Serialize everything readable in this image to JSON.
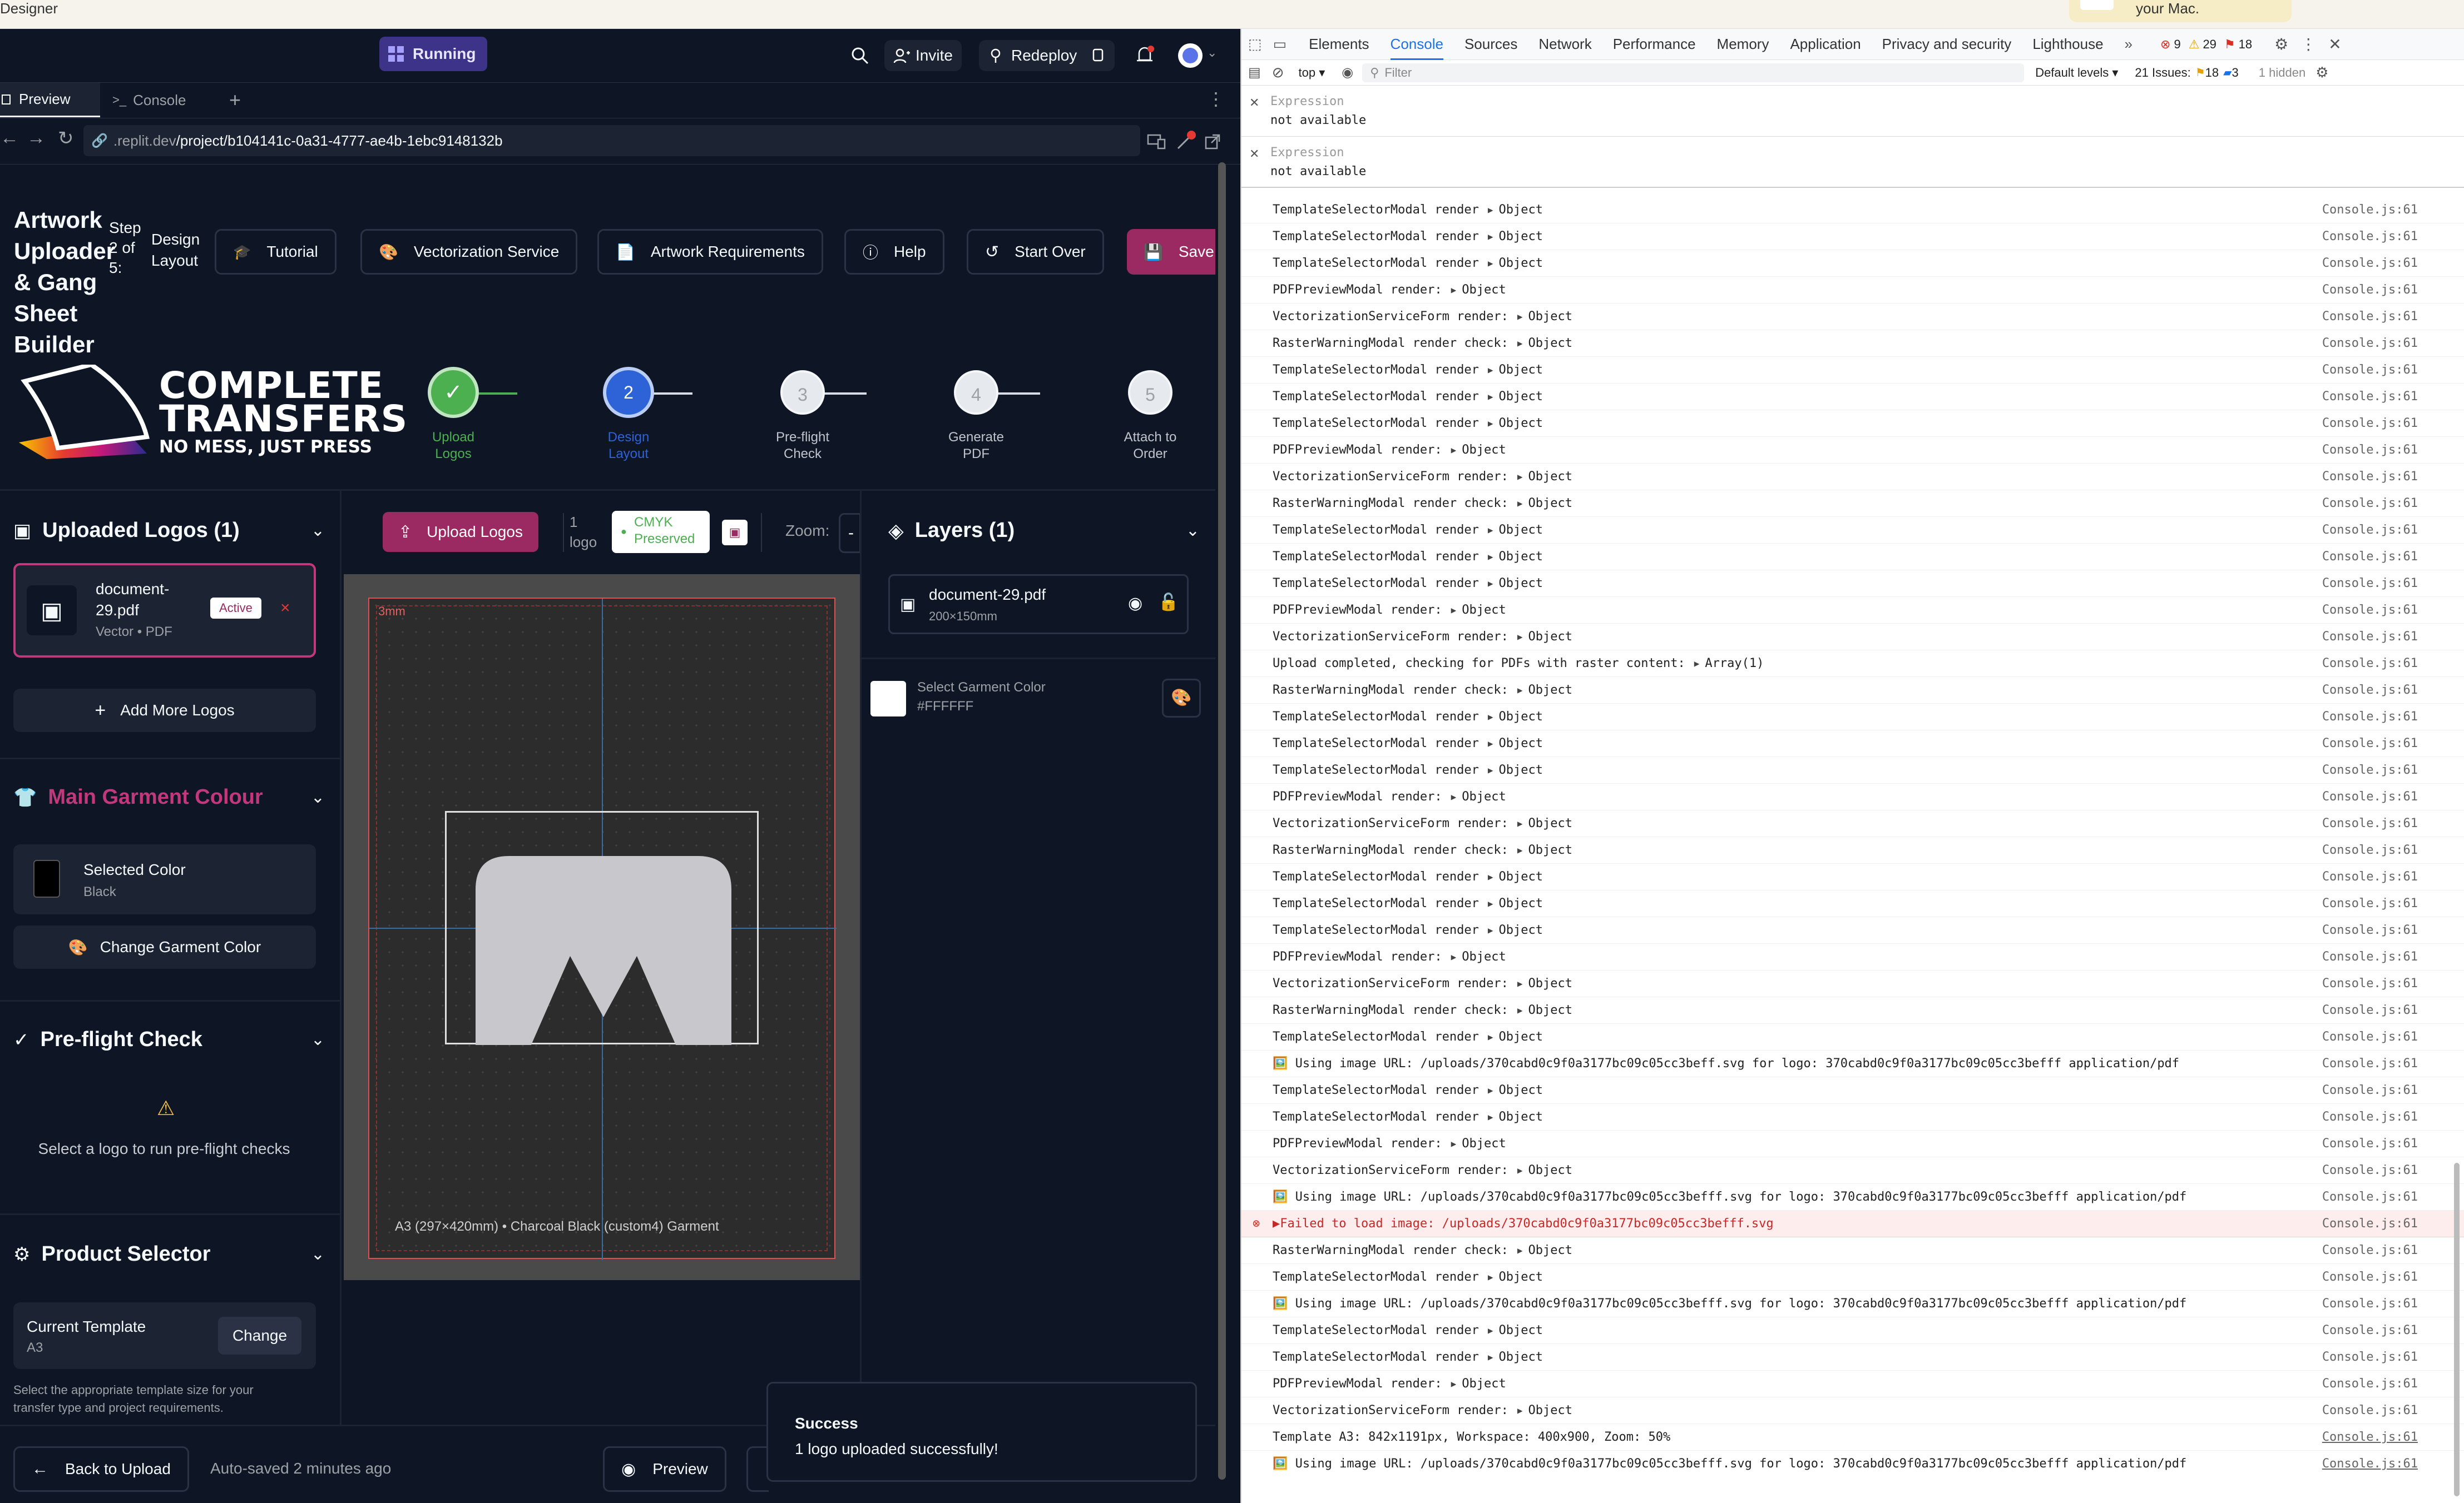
{
  "mac": {
    "app_name": "Designer",
    "notification": "your Mac."
  },
  "replit": {
    "running": "Running",
    "invite": "Invite",
    "redeploy": "Redeploy",
    "tabs": [
      {
        "label": "Preview"
      },
      {
        "label": "Console"
      }
    ],
    "url_dim": ".replit.dev",
    "url_path": "/project/b104141c-0a31-4777-ae4b-1ebc9148132b",
    "title": [
      "Artwork",
      "Uploader",
      "& Gang",
      "Sheet",
      "Builder"
    ],
    "step": [
      "Step",
      "2 of",
      "5:"
    ],
    "step_name": [
      "Design",
      "Layout"
    ],
    "toolbar": {
      "tutorial": "Tutorial",
      "vectorization": "Vectorization Service",
      "requirements": "Artwork Requirements",
      "help": "Help",
      "start_over": "Start Over",
      "save": "Save"
    },
    "logo": {
      "line1": "COMPLETE",
      "line2": "TRANSFERS",
      "tagline": "NO MESS, JUST PRESS"
    },
    "steps": [
      {
        "num": "✓",
        "l1": "Upload",
        "l2": "Logos"
      },
      {
        "num": "2",
        "l1": "Design",
        "l2": "Layout"
      },
      {
        "num": "3",
        "l1": "Pre-flight",
        "l2": "Check"
      },
      {
        "num": "4",
        "l1": "Generate",
        "l2": "PDF"
      },
      {
        "num": "5",
        "l1": "Attach to",
        "l2": "Order"
      }
    ],
    "left": {
      "uploaded_title": "Uploaded Logos (1)",
      "file_name_1": "document-",
      "file_name_2": "29.pdf",
      "file_meta": "Vector • PDF",
      "active": "Active",
      "add_more": "Add More Logos",
      "garment_title": "Main Garment Colour",
      "selected_color_label": "Selected Color",
      "selected_color_value": "Black",
      "change_color": "Change Garment Color",
      "preflight_title": "Pre-flight Check",
      "preflight_msg": "Select a logo to run pre-flight checks",
      "product_title": "Product Selector",
      "current_template_label": "Current Template",
      "current_template_value": "A3",
      "change": "Change",
      "product_desc_1": "Select the appropriate template size for your",
      "product_desc_2": "transfer type and project requirements."
    },
    "canvas": {
      "upload": "Upload Logos",
      "count_1": "1",
      "count_2": "logo",
      "cmyk_1": "CMYK",
      "cmyk_2": "Preserved",
      "zoom": "Zoom:",
      "bleed": "3mm",
      "footer": "A3 (297×420mm) • Charcoal Black (custom4) Garment"
    },
    "layers": {
      "title": "Layers (1)",
      "file": "document-29.pdf",
      "size": "200×150mm",
      "garment_label": "Select Garment Color",
      "garment_hex": "#FFFFFF"
    },
    "bottom": {
      "back": "Back to Upload",
      "autosave": "Auto-saved 2 minutes ago",
      "preview": "Preview"
    },
    "toast": {
      "title": "Success",
      "msg": "1 logo uploaded successfully!"
    },
    "colors": {
      "accent": "#9b2a62",
      "garment_title": "#c2387c",
      "success": "#4caf50",
      "step_active": "#2d63d6",
      "bg": "#0e1525"
    }
  },
  "devtools": {
    "tabs": [
      "Elements",
      "Console",
      "Sources",
      "Network",
      "Performance",
      "Memory",
      "Application",
      "Privacy and security",
      "Lighthouse"
    ],
    "badges": {
      "errors": "9",
      "warnings": "29",
      "issues": "18"
    },
    "context": "top",
    "filter": "Filter",
    "levels": "Default levels",
    "issues_label": "21 Issues:",
    "issues_warn": "18",
    "issues_info": "3",
    "hidden": "1 hidden",
    "expressions": [
      {
        "label": "Expression",
        "value": "not available"
      },
      {
        "label": "Expression",
        "value": "not available"
      }
    ],
    "logs": [
      {
        "text": "TemplateSelectorModal render",
        "obj": "Object"
      },
      {
        "text": "TemplateSelectorModal render",
        "obj": "Object"
      },
      {
        "text": "TemplateSelectorModal render",
        "obj": "Object"
      },
      {
        "text": "PDFPreviewModal render:",
        "obj": "Object"
      },
      {
        "text": "VectorizationServiceForm render:",
        "obj": "Object"
      },
      {
        "text": "RasterWarningModal render check:",
        "obj": "Object"
      },
      {
        "text": "TemplateSelectorModal render",
        "obj": "Object"
      },
      {
        "text": "TemplateSelectorModal render",
        "obj": "Object"
      },
      {
        "text": "TemplateSelectorModal render",
        "obj": "Object"
      },
      {
        "text": "PDFPreviewModal render:",
        "obj": "Object"
      },
      {
        "text": "VectorizationServiceForm render:",
        "obj": "Object"
      },
      {
        "text": "RasterWarningModal render check:",
        "obj": "Object"
      },
      {
        "text": "TemplateSelectorModal render",
        "obj": "Object"
      },
      {
        "text": "TemplateSelectorModal render",
        "obj": "Object"
      },
      {
        "text": "TemplateSelectorModal render",
        "obj": "Object"
      },
      {
        "text": "PDFPreviewModal render:",
        "obj": "Object"
      },
      {
        "text": "VectorizationServiceForm render:",
        "obj": "Object"
      },
      {
        "text": "Upload completed, checking for PDFs with raster content:",
        "obj": "Array(1)"
      },
      {
        "text": "RasterWarningModal render check:",
        "obj": "Object"
      },
      {
        "text": "TemplateSelectorModal render",
        "obj": "Object"
      },
      {
        "text": "TemplateSelectorModal render",
        "obj": "Object"
      },
      {
        "text": "TemplateSelectorModal render",
        "obj": "Object"
      },
      {
        "text": "PDFPreviewModal render:",
        "obj": "Object"
      },
      {
        "text": "VectorizationServiceForm render:",
        "obj": "Object"
      },
      {
        "text": "RasterWarningModal render check:",
        "obj": "Object"
      },
      {
        "text": "TemplateSelectorModal render",
        "obj": "Object"
      },
      {
        "text": "TemplateSelectorModal render",
        "obj": "Object"
      },
      {
        "text": "TemplateSelectorModal render",
        "obj": "Object"
      },
      {
        "text": "PDFPreviewModal render:",
        "obj": "Object"
      },
      {
        "text": "VectorizationServiceForm render:",
        "obj": "Object"
      },
      {
        "text": "RasterWarningModal render check:",
        "obj": "Object"
      },
      {
        "text": "TemplateSelectorModal render",
        "obj": "Object"
      },
      {
        "text": "🖼️ Using image URL: /uploads/370cabd0c9f0a3177bc09c05cc3beff.svg for logo: 370cabd0c9f0a3177bc09c05cc3befff application/pdf",
        "obj": ""
      },
      {
        "text": "TemplateSelectorModal render",
        "obj": "Object"
      },
      {
        "text": "TemplateSelectorModal render",
        "obj": "Object"
      },
      {
        "text": "PDFPreviewModal render:",
        "obj": "Object"
      },
      {
        "text": "VectorizationServiceForm render:",
        "obj": "Object"
      },
      {
        "text": "🖼️ Using image URL: /uploads/370cabd0c9f0a3177bc09c05cc3befff.svg for logo: 370cabd0c9f0a3177bc09c05cc3befff application/pdf",
        "obj": ""
      },
      {
        "text": "▶Failed to load image: /uploads/370cabd0c9f0a3177bc09c05cc3befff.svg",
        "obj": "",
        "err": true
      },
      {
        "text": "RasterWarningModal render check:",
        "obj": "Object"
      },
      {
        "text": "TemplateSelectorModal render",
        "obj": "Object"
      },
      {
        "text": "🖼️ Using image URL: /uploads/370cabd0c9f0a3177bc09c05cc3befff.svg for logo: 370cabd0c9f0a3177bc09c05cc3befff application/pdf",
        "obj": ""
      },
      {
        "text": "TemplateSelectorModal render",
        "obj": "Object"
      },
      {
        "text": "TemplateSelectorModal render",
        "obj": "Object"
      },
      {
        "text": "PDFPreviewModal render:",
        "obj": "Object"
      },
      {
        "text": "VectorizationServiceForm render:",
        "obj": "Object"
      },
      {
        "text": "Template A3: 842x1191px, Workspace: 400x900, Zoom: 50%",
        "obj": ""
      },
      {
        "text": "🖼️ Using image URL: /uploads/370cabd0c9f0a3177bc09c05cc3befff.svg for logo: 370cabd0c9f0a3177bc09c05cc3befff application/pdf",
        "obj": ""
      }
    ],
    "log_source": "Console.js:61",
    "prompt": ">"
  }
}
